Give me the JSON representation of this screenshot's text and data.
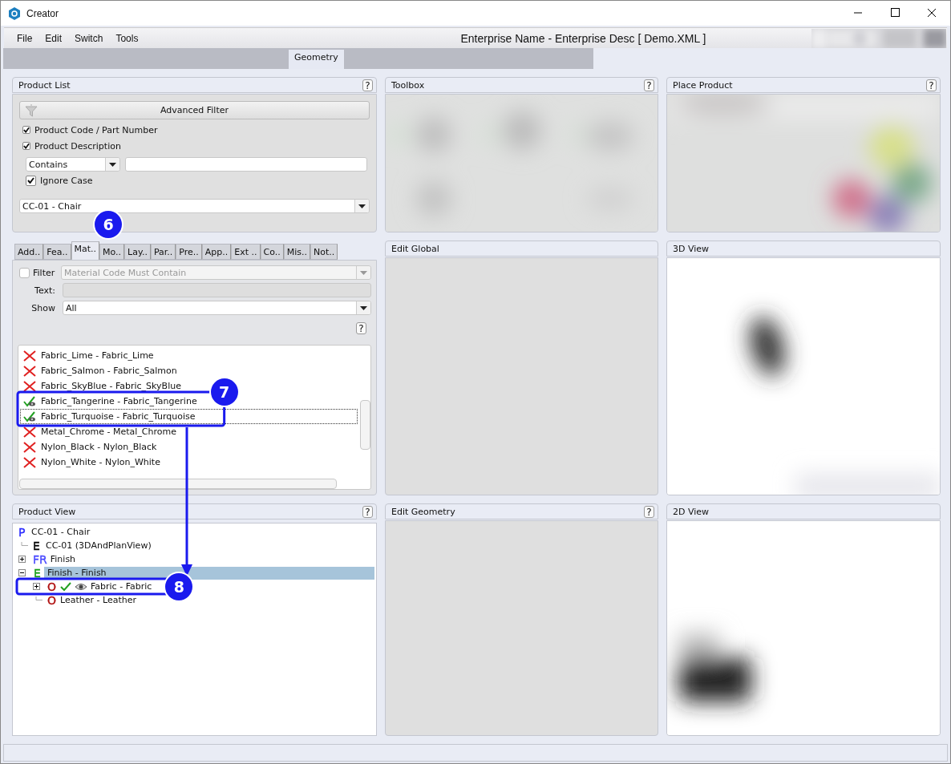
{
  "window": {
    "title": "Creator"
  },
  "menu": [
    "File",
    "Edit",
    "Switch",
    "Tools"
  ],
  "document_title": "Enterprise Name - Enterprise Desc [ Demo.XML ]",
  "tabs": [
    {
      "label": "Geometry",
      "selected": true
    }
  ],
  "product_list": {
    "title": "Product List",
    "help": "?",
    "filter_button": "Advanced Filter",
    "checks": [
      {
        "label": "Product Code / Part Number",
        "checked": true
      },
      {
        "label": "Product Description",
        "checked": true
      }
    ],
    "match_mode": "Contains",
    "ignore_case": {
      "label": "Ignore Case",
      "checked": true
    },
    "product": "CC-01 - Chair"
  },
  "property_tabs": [
    {
      "label": "Add..",
      "selected": false
    },
    {
      "label": "Fea..",
      "selected": false
    },
    {
      "label": "Mat..",
      "selected": true
    },
    {
      "label": "Mo..",
      "selected": false
    },
    {
      "label": "Lay..",
      "selected": false
    },
    {
      "label": "Par..",
      "selected": false
    },
    {
      "label": "Pre..",
      "selected": false
    },
    {
      "label": "App..",
      "selected": false
    },
    {
      "label": "Ext ..",
      "selected": false
    },
    {
      "label": "Co..",
      "selected": false
    },
    {
      "label": "Mis..",
      "selected": false
    },
    {
      "label": "Not..",
      "selected": false
    }
  ],
  "materials": {
    "filter": {
      "label": "Filter",
      "checked": false,
      "value": "Material Code Must Contain",
      "disabled": true
    },
    "text_label": "Text:",
    "text_disabled": true,
    "show_label": "Show",
    "show_value": "All",
    "help": "?",
    "items": [
      {
        "label": "Fabric_Lime - Fabric_Lime",
        "kind": "excluded",
        "focused": false
      },
      {
        "label": "Fabric_Salmon - Fabric_Salmon",
        "kind": "excluded",
        "focused": false
      },
      {
        "label": "Fabric_SkyBlue - Fabric_SkyBlue",
        "kind": "excluded",
        "focused": false
      },
      {
        "label": "Fabric_Tangerine - Fabric_Tangerine",
        "kind": "included",
        "focused": false
      },
      {
        "label": "Fabric_Turquoise - Fabric_Turquoise",
        "kind": "included",
        "focused": true
      },
      {
        "label": "Metal_Chrome - Metal_Chrome",
        "kind": "excluded",
        "focused": false
      },
      {
        "label": "Nylon_Black - Nylon_Black",
        "kind": "excluded",
        "focused": false
      },
      {
        "label": "Nylon_White - Nylon_White",
        "kind": "excluded",
        "focused": false
      }
    ]
  },
  "product_view": {
    "title": "Product View",
    "help": "?",
    "tree": [
      {
        "letter": "P",
        "color": "#2a2aff",
        "label": "CC-01 - Chair",
        "selected": false,
        "checked": false,
        "visible": false,
        "children": [
          {
            "letter": "E",
            "color": "#000000",
            "label": "CC-01 (3DAndPlanView)",
            "selected": false,
            "checked": false,
            "visible": false
          },
          {
            "letter": "FR",
            "color": "#4a4aff",
            "label": "Finish",
            "selected": false,
            "checked": false,
            "visible": false,
            "expanded": false
          },
          {
            "letter": "E",
            "color": "#18a018",
            "label": "Finish - Finish",
            "selected": true,
            "checked": false,
            "visible": false,
            "expanded": true,
            "children": [
              {
                "letter": "O",
                "color": "#b01010",
                "label": "Fabric - Fabric",
                "selected": false,
                "checked": true,
                "visible": true,
                "expanded": false
              },
              {
                "letter": "O",
                "color": "#b01010",
                "label": "Leather - Leather",
                "selected": false,
                "checked": false,
                "visible": false
              }
            ]
          }
        ]
      }
    ]
  },
  "panels": [
    {
      "title": "Toolbox",
      "help": "?",
      "kind": "blurred-tools"
    },
    {
      "title": "Place Product",
      "help": "?",
      "kind": "blurred-colors"
    },
    {
      "title": "Edit Global",
      "kind": "empty"
    },
    {
      "title": "3D View",
      "kind": "view3d"
    },
    {
      "title": "Edit Geometry",
      "help": "?",
      "kind": "empty"
    },
    {
      "title": "2D View",
      "kind": "view2d"
    }
  ],
  "callouts": [
    {
      "label": "6"
    },
    {
      "label": "7"
    },
    {
      "label": "8"
    }
  ]
}
